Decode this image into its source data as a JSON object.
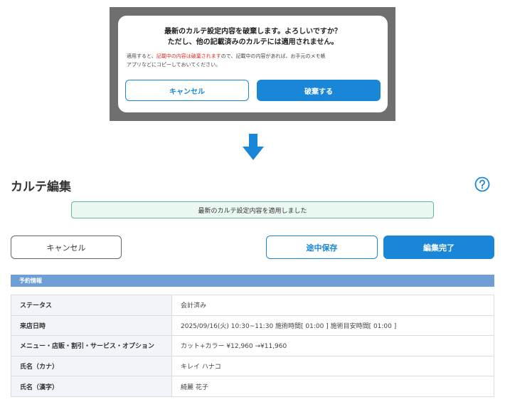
{
  "dialog": {
    "title_line1": "最新のカルテ設定内容を破棄します。よろしいですか？",
    "title_line2": "ただし、他の記載済みのカルテには適用されません。",
    "note_prefix": "適用すると、",
    "note_highlight": "記載中の内容は破棄されます",
    "note_suffix": "ので、記載中の内容があれば、お手元のメモ帳",
    "note_line2": "アプリなどにコピーしておいてください。",
    "cancel_label": "キャンセル",
    "discard_label": "破棄する"
  },
  "page": {
    "title": "カルテ編集",
    "notice": "最新のカルテ設定内容を適用しました",
    "cancel_label": "キャンセル",
    "save_draft_label": "途中保存",
    "complete_label": "編集完了",
    "section_title": "予約情報",
    "rows": [
      {
        "label": "ステータス",
        "value": "会計済み"
      },
      {
        "label": "来店日時",
        "value": "2025/09/16(火) 10:30~11:30 施術時間[ 01:00 ] 施術目安時間[ 01:00 ]"
      },
      {
        "label": "メニュー・店販・割引・サービス・オプション",
        "value": "カット+カラー ¥12,960 →¥11,960"
      },
      {
        "label": "氏名（カナ）",
        "value": "キレイ ハナコ"
      },
      {
        "label": "氏名（漢字）",
        "value": "綺麗 花子"
      }
    ]
  },
  "colors": {
    "accent": "#1a86d8",
    "warning_red": "#e0271f",
    "section_header": "#6d9fd6",
    "notice_bg": "#eaf8f2",
    "notice_border": "#62b79a"
  },
  "icons": {
    "arrow": "arrow-down-icon",
    "help": "question-circle-icon"
  }
}
